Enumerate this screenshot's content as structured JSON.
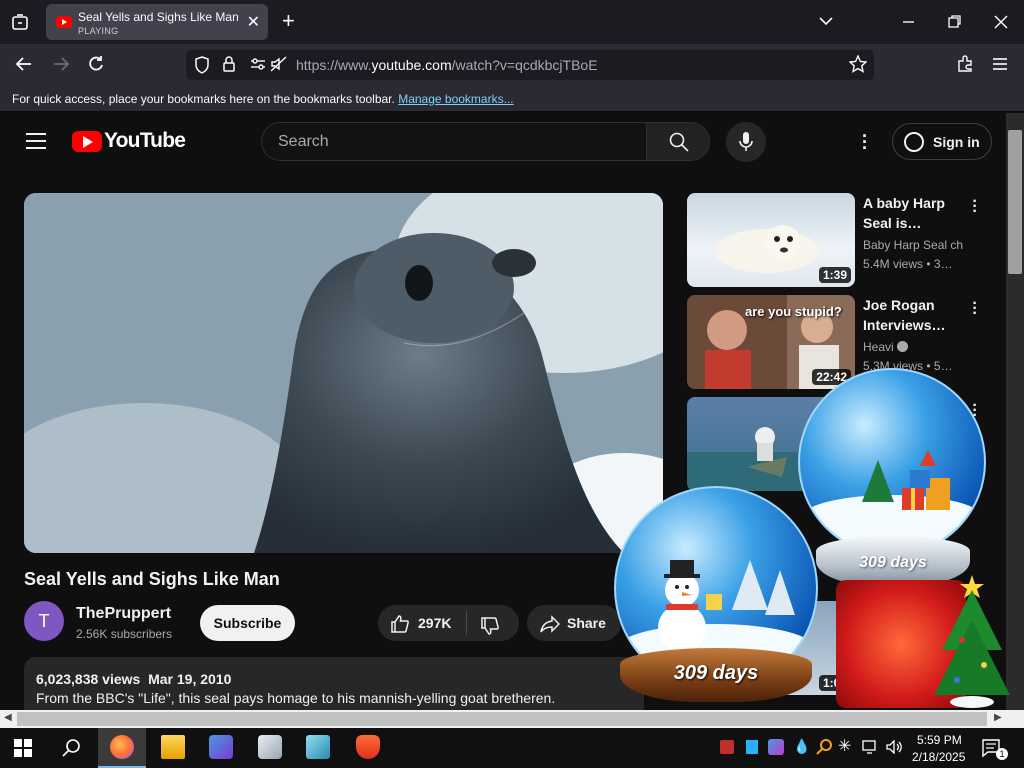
{
  "browser": {
    "tab": {
      "title": "Seal Yells and Sighs Like Man -",
      "status": "PLAYING"
    },
    "url": {
      "prefix": "https://www.",
      "domain": "youtube.com",
      "path": "/watch?v=qcdkbcjTBoE"
    },
    "bookmarks_bar": {
      "message": "For quick access, place your bookmarks here on the bookmarks toolbar.",
      "link": "Manage bookmarks..."
    }
  },
  "youtube": {
    "logo_text": "YouTube",
    "search_placeholder": "Search",
    "sign_in": "Sign in",
    "video": {
      "title": "Seal Yells and Sighs Like Man",
      "channel_initial": "T",
      "channel": "ThePruppert",
      "subscribers": "2.56K subscribers",
      "subscribe_label": "Subscribe",
      "likes": "297K",
      "share_label": "Share",
      "views": "6,023,838 views",
      "date": "Mar 19, 2010",
      "description": "From the BBC's \"Life\", this seal pays homage to his mannish-yelling goat bretheren."
    },
    "recommendations": [
      {
        "title": "A baby Harp Seal is…",
        "channel": "Baby Harp Seal ch",
        "views": "5.4M views",
        "age": "3…",
        "duration": "1:39"
      },
      {
        "title": "Joe Rogan Interviews…",
        "channel": "Heavi",
        "views": "5.3M views",
        "age": "5…",
        "duration": "22:42",
        "thumb_text": "are you stupid?"
      },
      {
        "title": "",
        "channel": "",
        "views": "",
        "age": "",
        "duration": ""
      },
      {
        "title": "",
        "channel": "",
        "views": "",
        "age": "",
        "duration": "1:00"
      }
    ]
  },
  "gadgets": {
    "globe_days_1": "309 days",
    "globe_days_2": "309 days"
  },
  "taskbar": {
    "time": "5:59 PM",
    "date": "2/18/2025",
    "notifications": "1"
  },
  "colors": {
    "yt_red": "#ff0000",
    "page_bg": "#0f0f0f",
    "chrome_bg": "#2b2a33",
    "link": "#7bd0ff"
  }
}
